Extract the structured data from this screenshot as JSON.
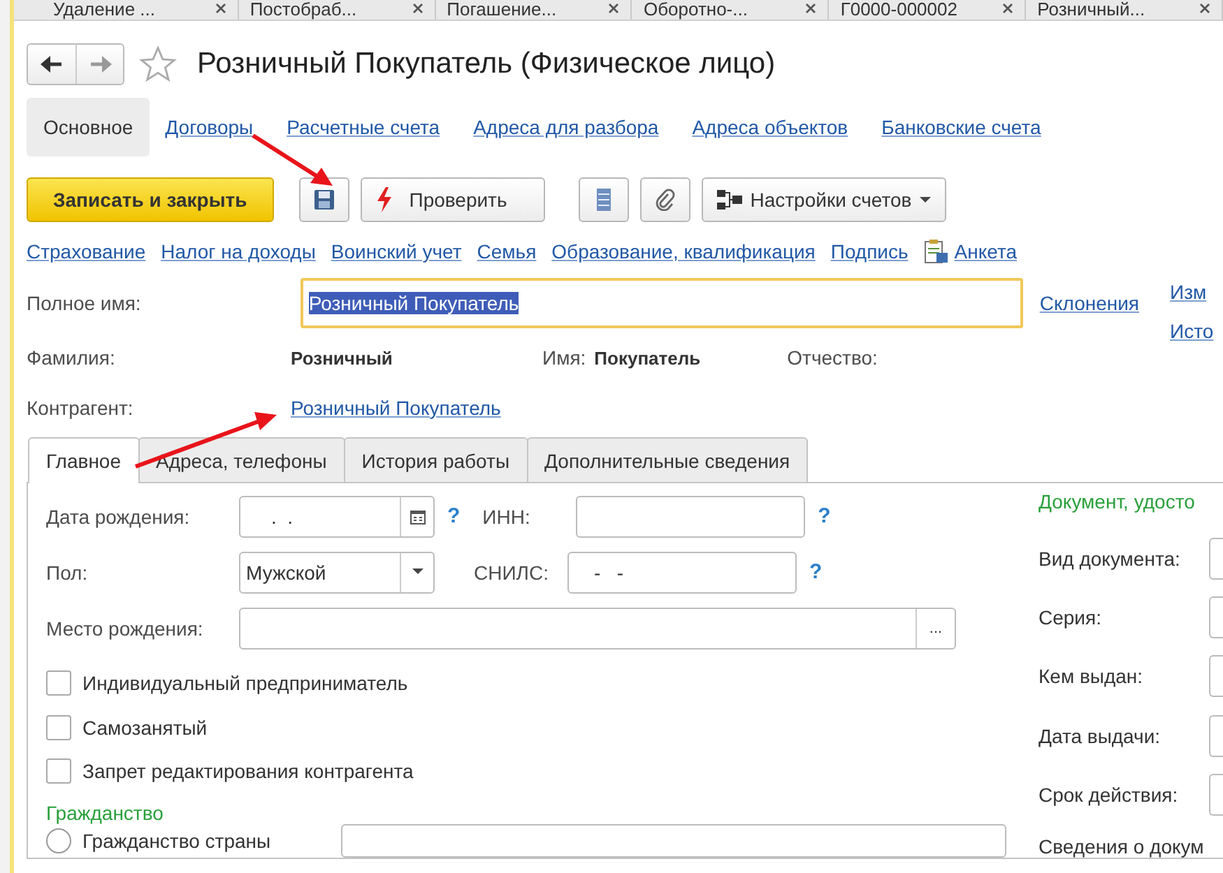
{
  "window_tabs": [
    {
      "label": "Удаление ..."
    },
    {
      "label": "Постобраб..."
    },
    {
      "label": "Погашение..."
    },
    {
      "label": "Оборотно-..."
    },
    {
      "label": "Г0000-000002"
    },
    {
      "label": "Розничный..."
    }
  ],
  "title": "Розничный Покупатель (Физическое лицо)",
  "sections": [
    {
      "label": "Основное",
      "selected": true
    },
    {
      "label": "Договоры",
      "selected": false
    },
    {
      "label": "Расчетные счета",
      "selected": false
    },
    {
      "label": "Адреса для разбора",
      "selected": false
    },
    {
      "label": "Адреса объектов",
      "selected": false
    },
    {
      "label": "Банковские счета",
      "selected": false
    }
  ],
  "toolbar": [
    {
      "kind": "primary",
      "label": "Записать и закрыть"
    },
    {
      "kind": "save"
    },
    {
      "kind": "check",
      "label": "Проверить"
    },
    {
      "kind": "list"
    },
    {
      "kind": "attach"
    },
    {
      "kind": "settings",
      "label": "Настройки счетов"
    }
  ],
  "links": [
    {
      "label": "Страхование"
    },
    {
      "label": "Налог на доходы"
    },
    {
      "label": "Воинский учет"
    },
    {
      "label": "Семья"
    },
    {
      "label": "Образование, квалификация"
    },
    {
      "label": "Подпись"
    },
    {
      "label": "Анкета",
      "kind": "form"
    }
  ],
  "full_name": {
    "label": "Полное имя:",
    "value": "Розничный Покупатель",
    "link": "Склонения"
  },
  "side_links": [
    "Изм",
    "Исто"
  ],
  "surname": {
    "label": "Фамилия:",
    "value": "Розничный"
  },
  "first_name": {
    "label": "Имя:",
    "value": "Покупатель"
  },
  "patronymic": {
    "label": "Отчество:"
  },
  "counterparty": {
    "label": "Контрагент:",
    "value": "Розничный Покупатель"
  },
  "form_tabs": [
    {
      "label": "Главное",
      "selected": true
    },
    {
      "label": "Адреса, телефоны",
      "selected": false
    },
    {
      "label": "История работы",
      "selected": false
    },
    {
      "label": "Дополнительные сведения",
      "selected": false
    }
  ],
  "main": {
    "birth_date": {
      "label": "Дата рождения:",
      "value": ".  .",
      "help": "?"
    },
    "inn": {
      "label": "ИНН:",
      "help": "?"
    },
    "gender": {
      "label": "Пол:",
      "value": "Мужской"
    },
    "snils": {
      "label": "СНИЛС:",
      "value": "-   -",
      "help": "?"
    },
    "birthplace": {
      "label": "Место рождения:",
      "button": "..."
    },
    "checkboxes": [
      {
        "label": "Индивидуальный предприниматель",
        "checked": false
      },
      {
        "label": "Самозанятый",
        "checked": false
      },
      {
        "label": "Запрет редактирования контрагента",
        "checked": false
      }
    ],
    "citizenship": {
      "title": "Гражданство",
      "option": "Гражданство страны",
      "selected": false
    }
  },
  "document": {
    "title": "Документ, удосто",
    "fields": [
      "Вид документа:",
      "Серия:",
      "Кем выдан:",
      "Дата выдачи:",
      "Срок действия:"
    ],
    "more": "Сведения о докум"
  }
}
